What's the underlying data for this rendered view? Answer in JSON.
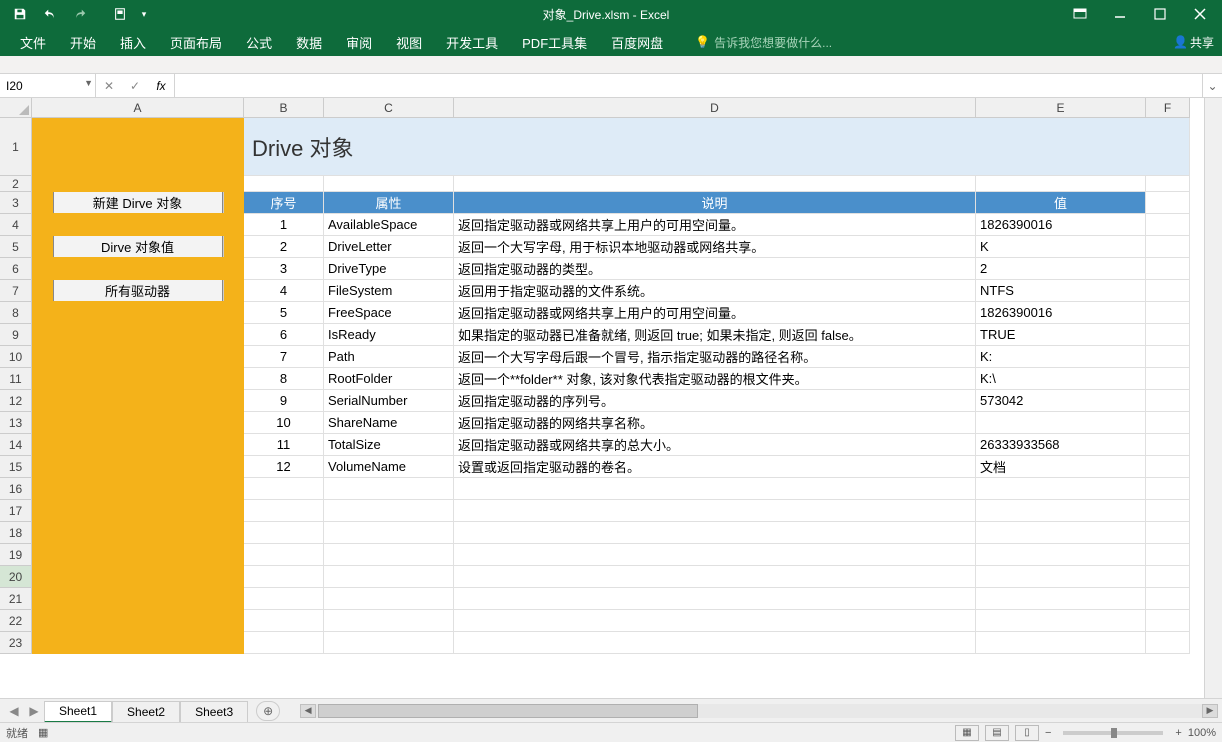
{
  "app": {
    "title": "对象_Drive.xlsm - Excel"
  },
  "ribbon": {
    "tabs": [
      "文件",
      "开始",
      "插入",
      "页面布局",
      "公式",
      "数据",
      "审阅",
      "视图",
      "开发工具",
      "PDF工具集",
      "百度网盘"
    ],
    "tellme": "告诉我您想要做什么...",
    "share": "共享"
  },
  "formula": {
    "name_box": "I20",
    "fx": "fx",
    "value": ""
  },
  "columns": [
    "A",
    "B",
    "C",
    "D",
    "E",
    "F"
  ],
  "rows_visible": 23,
  "sheet": {
    "title": "Drive 对象",
    "buttons": [
      "新建 Dirve 对象",
      "Dirve 对象值",
      "所有驱动器"
    ],
    "headers": {
      "seq": "序号",
      "prop": "属性",
      "desc": "说明",
      "val": "值"
    },
    "data": [
      {
        "n": "1",
        "p": "AvailableSpace",
        "d": "返回指定驱动器或网络共享上用户的可用空间量。",
        "v": "1826390016"
      },
      {
        "n": "2",
        "p": "DriveLetter",
        "d": "返回一个大写字母, 用于标识本地驱动器或网络共享。",
        "v": "K"
      },
      {
        "n": "3",
        "p": "DriveType",
        "d": "返回指定驱动器的类型。",
        "v": "2"
      },
      {
        "n": "4",
        "p": "FileSystem",
        "d": "返回用于指定驱动器的文件系统。",
        "v": "NTFS"
      },
      {
        "n": "5",
        "p": "FreeSpace",
        "d": "返回指定驱动器或网络共享上用户的可用空间量。",
        "v": "1826390016"
      },
      {
        "n": "6",
        "p": "IsReady",
        "d": "如果指定的驱动器已准备就绪, 则返回 true; 如果未指定, 则返回 false。",
        "v": "TRUE"
      },
      {
        "n": "7",
        "p": "Path",
        "d": "返回一个大写字母后跟一个冒号, 指示指定驱动器的路径名称。",
        "v": "K:"
      },
      {
        "n": "8",
        "p": "RootFolder",
        "d": "返回一个**folder** 对象, 该对象代表指定驱动器的根文件夹。",
        "v": "K:\\"
      },
      {
        "n": "9",
        "p": "SerialNumber",
        "d": "返回指定驱动器的序列号。",
        "v": "573042"
      },
      {
        "n": "10",
        "p": "ShareName",
        "d": "返回指定驱动器的网络共享名称。",
        "v": ""
      },
      {
        "n": "11",
        "p": "TotalSize",
        "d": "返回指定驱动器或网络共享的总大小。",
        "v": "26333933568"
      },
      {
        "n": "12",
        "p": "VolumeName",
        "d": "设置或返回指定驱动器的卷名。",
        "v": "文档"
      }
    ]
  },
  "tabs": {
    "sheets": [
      "Sheet1",
      "Sheet2",
      "Sheet3"
    ],
    "active": 0
  },
  "status": {
    "ready": "就绪",
    "zoom": "100%"
  }
}
